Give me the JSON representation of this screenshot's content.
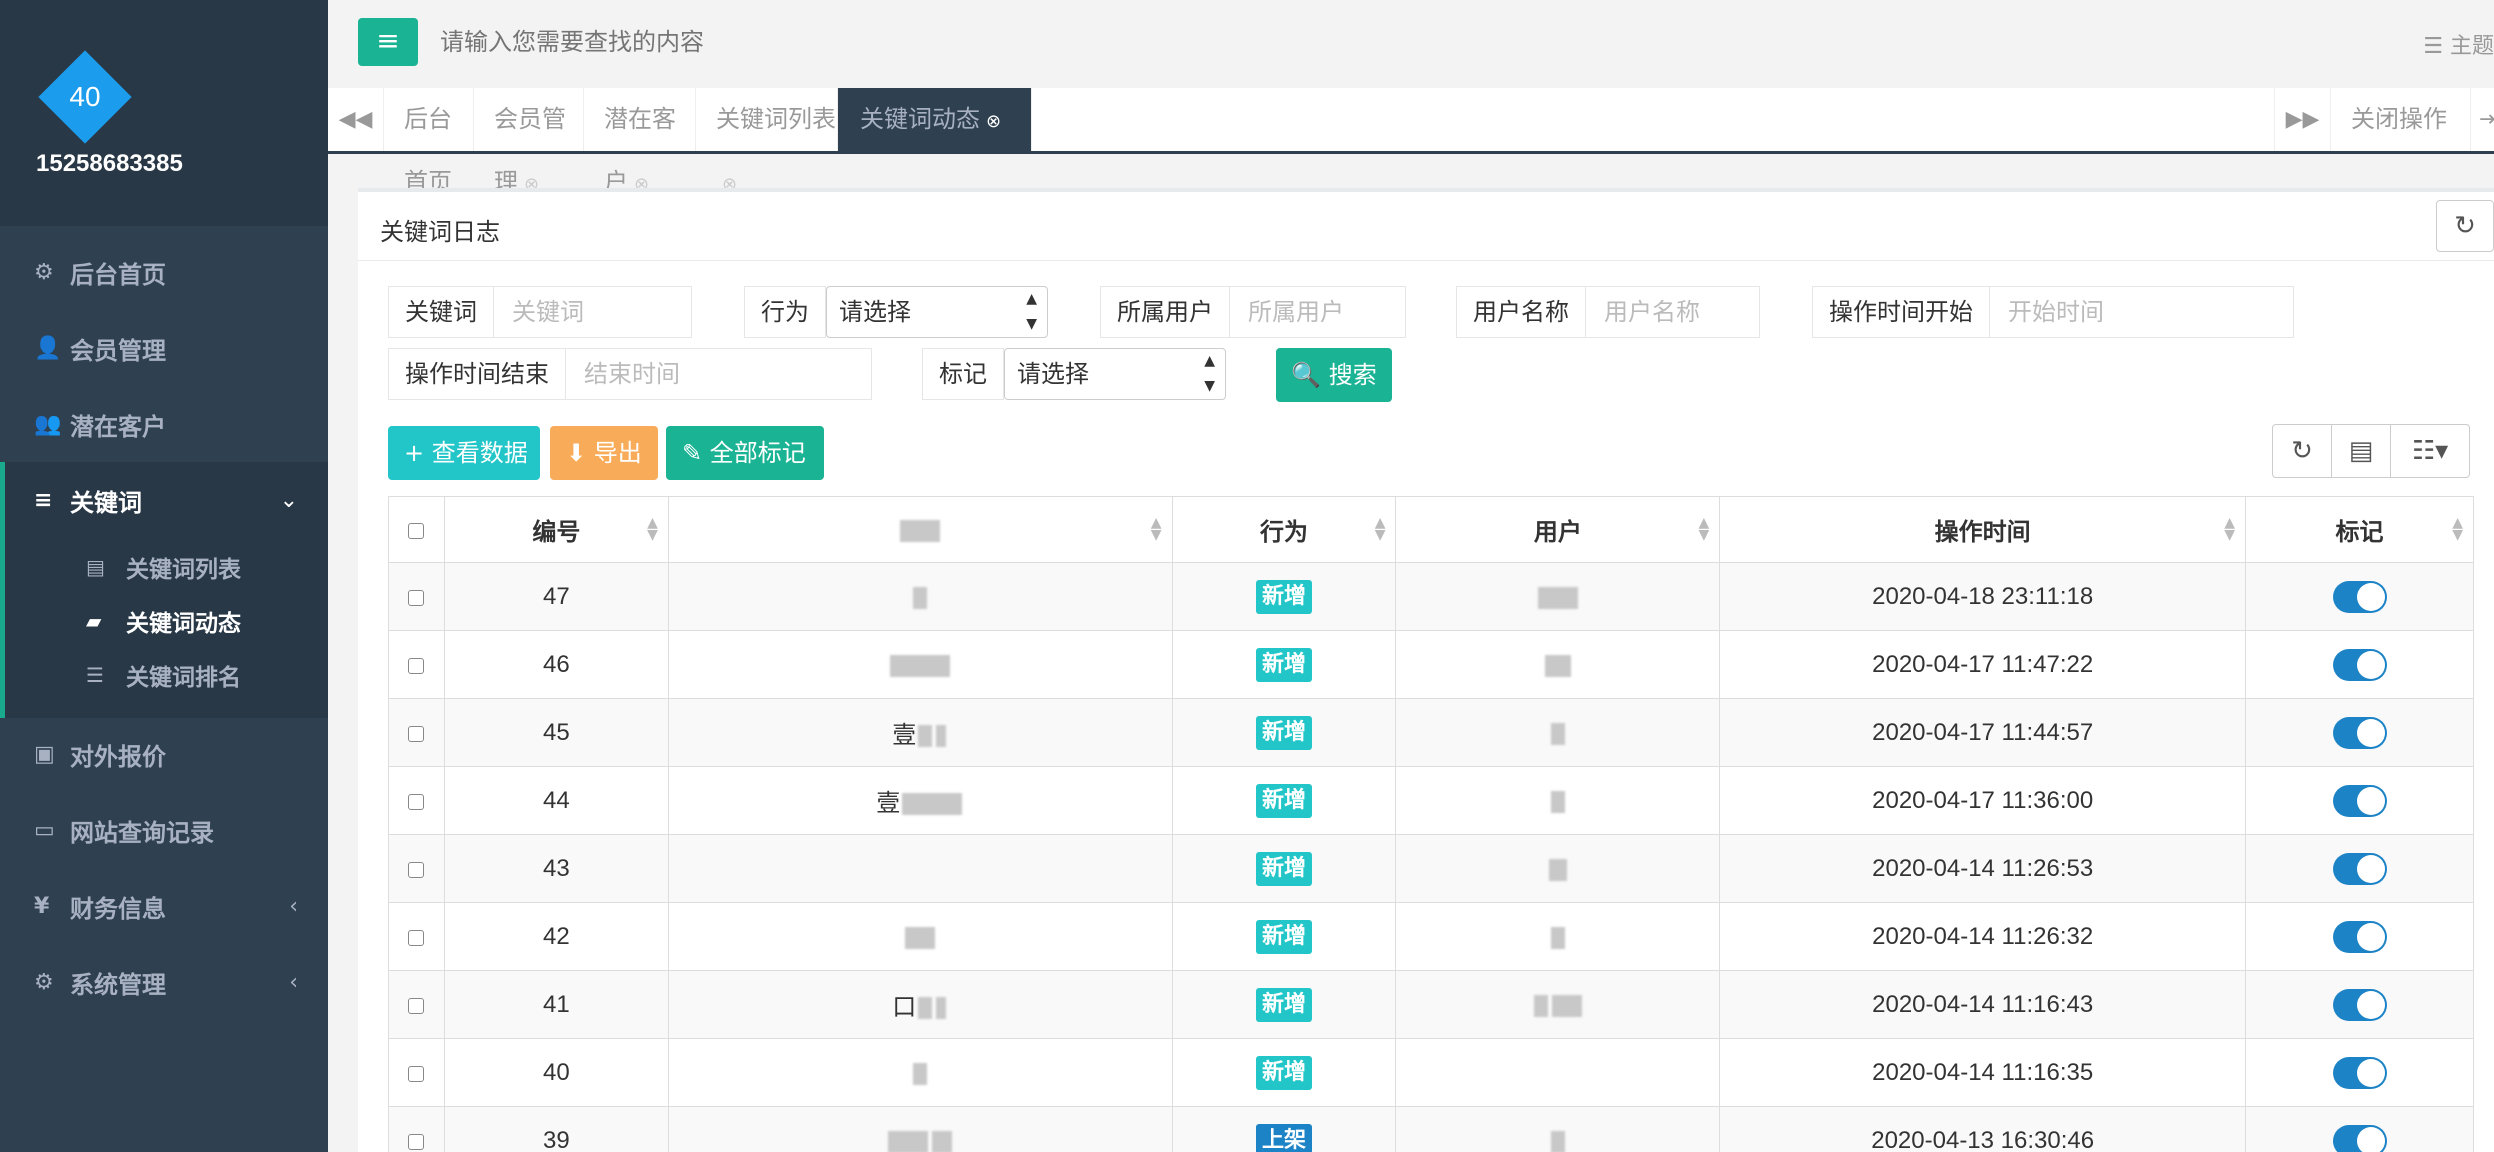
{
  "user": {
    "avatar_text": "40",
    "username": "15258683385"
  },
  "sidebar": {
    "items": [
      {
        "icon": "gears-icon",
        "glyph": "⚙",
        "label": "后台首页"
      },
      {
        "icon": "user-icon",
        "glyph": "👤",
        "label": "会员管理"
      },
      {
        "icon": "user-plus-icon",
        "glyph": "👥",
        "label": "潜在客户"
      },
      {
        "icon": "bars-icon",
        "glyph": "≡",
        "label": "关键词",
        "arrow": "⌄"
      },
      {
        "icon": "money-icon",
        "glyph": "▣",
        "label": "对外报价"
      },
      {
        "icon": "desktop-icon",
        "glyph": "▭",
        "label": "网站查询记录"
      },
      {
        "icon": "yen-icon",
        "glyph": "¥",
        "label": "财务信息",
        "arrow": "‹"
      },
      {
        "icon": "gears-icon",
        "glyph": "⚙",
        "label": "系统管理",
        "arrow": "‹"
      }
    ],
    "sub_items": [
      {
        "icon": "list-alt-icon",
        "glyph": "▤",
        "label": "关键词列表"
      },
      {
        "icon": "book-icon",
        "glyph": "▰",
        "label": "关键词动态"
      },
      {
        "icon": "list-ol-icon",
        "glyph": "☰",
        "label": "关键词排名"
      }
    ]
  },
  "topbar": {
    "menu_glyph": "≡",
    "search_placeholder": "请输入您需要查找的内容",
    "theme_label": "主题"
  },
  "tabs": {
    "prev_glyph": "◀◀",
    "next_glyph": "▶▶",
    "items": [
      {
        "label": "后台首页",
        "closable": false
      },
      {
        "label": "会员管理",
        "closable": true
      },
      {
        "label": "潜在客户",
        "closable": true
      },
      {
        "label": "关键词列表",
        "closable": true
      },
      {
        "label": "关键词动态",
        "closable": true,
        "active": true
      }
    ],
    "close_glyph": "⊗",
    "close_ops_label": "关闭操作",
    "exit_glyph": "⇥"
  },
  "panel": {
    "title": "关键词日志",
    "refresh_glyph": "↻",
    "filters": {
      "keyword_label": "关键词",
      "keyword_placeholder": "关键词",
      "behavior_label": "行为",
      "behavior_value": "请选择",
      "owner_label": "所属用户",
      "owner_placeholder": "所属用户",
      "username_label": "用户名称",
      "username_placeholder": "用户名称",
      "start_label": "操作时间开始",
      "start_placeholder": "开始时间",
      "end_label": "操作时间结束",
      "end_placeholder": "结束时间",
      "mark_label": "标记",
      "mark_value": "请选择",
      "search_label": "🔍 搜索"
    },
    "actions": {
      "view": "+ 查看数据",
      "export": "⬇ 导出",
      "mark_all": "✎ 全部标记"
    },
    "tools": {
      "refresh": "↻",
      "toggle": "▤",
      "columns": "☷▾"
    },
    "table": {
      "headers": [
        "编号",
        "",
        "行为",
        "用户",
        "操作时间",
        "标记"
      ],
      "rows": [
        {
          "id": "47",
          "keyword": "",
          "action": "新增",
          "user": "",
          "time": "2020-04-18 23:11:18",
          "marked": true
        },
        {
          "id": "46",
          "keyword": "",
          "action": "新增",
          "user": "",
          "time": "2020-04-17 11:47:22",
          "marked": true
        },
        {
          "id": "45",
          "keyword": "壹",
          "action": "新增",
          "user": "",
          "time": "2020-04-17 11:44:57",
          "marked": true
        },
        {
          "id": "44",
          "keyword": "壹",
          "action": "新增",
          "user": "",
          "time": "2020-04-17 11:36:00",
          "marked": true
        },
        {
          "id": "43",
          "keyword": "",
          "action": "新增",
          "user": "",
          "time": "2020-04-14 11:26:53",
          "marked": true
        },
        {
          "id": "42",
          "keyword": "",
          "action": "新增",
          "user": "",
          "time": "2020-04-14 11:26:32",
          "marked": true
        },
        {
          "id": "41",
          "keyword": "口",
          "action": "新增",
          "user": "",
          "time": "2020-04-14 11:16:43",
          "marked": true
        },
        {
          "id": "40",
          "keyword": "",
          "action": "新增",
          "user": "",
          "time": "2020-04-14 11:16:35",
          "marked": true
        },
        {
          "id": "39",
          "keyword": "",
          "action": "上架",
          "user": "",
          "time": "2020-04-13 16:30:46",
          "marked": true
        }
      ]
    }
  },
  "colors": {
    "sidebar_bg": "#2f4050",
    "primary": "#1ab394",
    "info": "#23c6c8",
    "warning": "#f8ac59",
    "toggle_on": "#1c84c6"
  }
}
